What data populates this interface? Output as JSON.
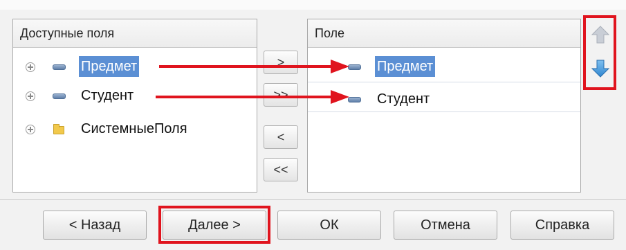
{
  "left_panel": {
    "header": "Доступные поля",
    "items": [
      {
        "label": "Предмет",
        "icon": "field-icon",
        "selected": true
      },
      {
        "label": "Студент",
        "icon": "field-icon",
        "selected": false
      },
      {
        "label": "СистемныеПоля",
        "icon": "folder-icon",
        "selected": false
      }
    ]
  },
  "transfer_buttons": [
    ">",
    ">>",
    "<",
    "<<"
  ],
  "right_panel": {
    "header": "Поле",
    "items": [
      {
        "label": "Предмет",
        "icon": "field-icon",
        "selected": true
      },
      {
        "label": "Студент",
        "icon": "field-icon",
        "selected": false
      }
    ]
  },
  "order_buttons": {
    "up": "arrow-up-icon",
    "down": "arrow-down-icon"
  },
  "footer": {
    "back": "< Назад",
    "next": "Далее >",
    "ok": "ОК",
    "cancel": "Отмена",
    "help": "Справка"
  },
  "colors": {
    "selection": "#5b8fd4",
    "highlight": "#e0141e"
  }
}
